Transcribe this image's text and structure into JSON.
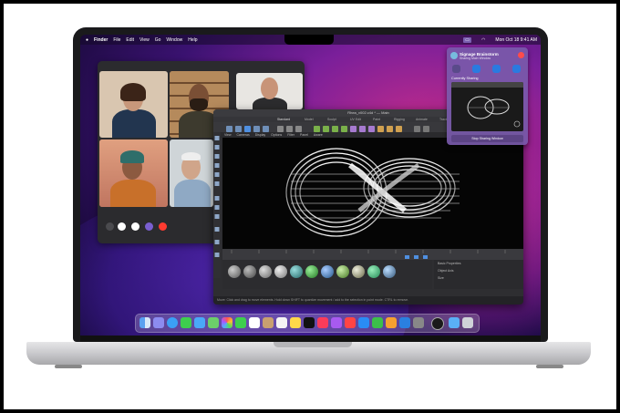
{
  "menubar": {
    "apple": "",
    "items": [
      "Finder",
      "File",
      "Edit",
      "View",
      "Go",
      "Window",
      "Help"
    ],
    "clock": "Mon Oct 18  9:41 AM"
  },
  "cinema4d": {
    "title": "Rhea_v002.c4d * — Main",
    "tabs": [
      "Standard",
      "Model",
      "Sculpt",
      "UV Edit",
      "Paint",
      "Rigging",
      "Animate",
      "Track",
      "Script"
    ],
    "menu": [
      "View",
      "Cameras",
      "Display",
      "Options",
      "Filter",
      "Panel",
      "Aware"
    ],
    "status": "Move: Click and drag to move elements. Hold down SHIFT to quantize movement / add to the selection in point mode. CTRL to remove.",
    "attr_rows": [
      "Basic Properties",
      "Object Axis",
      "Size"
    ]
  },
  "share_panel": {
    "title": "Signage Brainstorm",
    "subtitle": "Sharing Main Window",
    "currently": "Currently Sharing",
    "stop": "Stop Sharing Window"
  },
  "colors": {
    "accent": "#7a5fb0",
    "close": "#ff4b4b"
  }
}
